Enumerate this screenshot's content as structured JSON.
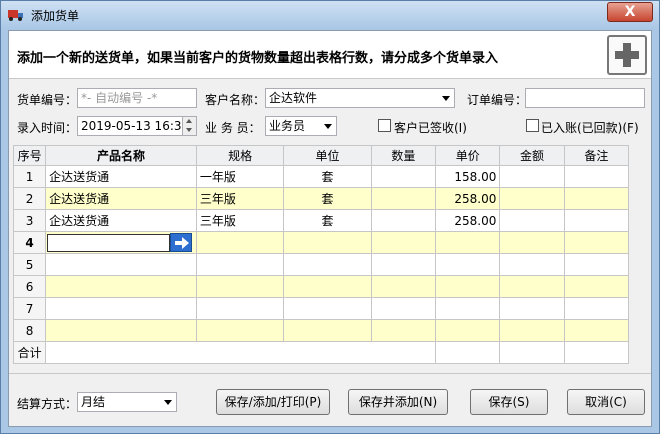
{
  "window": {
    "title": "添加货单",
    "close_label": "X"
  },
  "banner": {
    "text": "添加一个新的送货单，如果当前客户的货物数量超出表格行数，请分成多个货单录入"
  },
  "form": {
    "order_no_label": "货单编号：",
    "order_no_placeholder": "*- 自动编号 -*",
    "customer_label": "客户名称：",
    "customer_value": "企达软件",
    "po_no_label": "订单编号：",
    "po_no_value": "",
    "entry_time_label": "录入时间：",
    "entry_time_value": "2019-05-13 16:30",
    "clerk_label": "业 务 员：",
    "clerk_value": "业务员",
    "signed_label": "客户已签收(I)",
    "signed_checked": false,
    "paid_label": "已入账(已回款)(F)",
    "paid_checked": false
  },
  "table": {
    "columns": [
      "序号",
      "产品名称",
      "规格",
      "单位",
      "数量",
      "单价",
      "金额",
      "备注"
    ],
    "rows": [
      {
        "no": "1",
        "name": "企达送货通",
        "spec": "一年版",
        "unit": "套",
        "qty": "",
        "price": "158.00",
        "amount": "",
        "note": ""
      },
      {
        "no": "2",
        "name": "企达送货通",
        "spec": "三年版",
        "unit": "套",
        "qty": "",
        "price": "258.00",
        "amount": "",
        "note": ""
      },
      {
        "no": "3",
        "name": "企达送货通",
        "spec": "三年版",
        "unit": "套",
        "qty": "",
        "price": "258.00",
        "amount": "",
        "note": ""
      },
      {
        "no": "4",
        "name": "",
        "spec": "",
        "unit": "",
        "qty": "",
        "price": "",
        "amount": "",
        "note": ""
      },
      {
        "no": "5",
        "name": "",
        "spec": "",
        "unit": "",
        "qty": "",
        "price": "",
        "amount": "",
        "note": ""
      },
      {
        "no": "6",
        "name": "",
        "spec": "",
        "unit": "",
        "qty": "",
        "price": "",
        "amount": "",
        "note": ""
      },
      {
        "no": "7",
        "name": "",
        "spec": "",
        "unit": "",
        "qty": "",
        "price": "",
        "amount": "",
        "note": ""
      },
      {
        "no": "8",
        "name": "",
        "spec": "",
        "unit": "",
        "qty": "",
        "price": "",
        "amount": "",
        "note": ""
      }
    ],
    "total_label": "合计"
  },
  "footer": {
    "settlement_label": "结算方式：",
    "settlement_value": "月结",
    "btn_save_add_print": "保存/添加/打印(P)",
    "btn_save_add": "保存并添加(N)",
    "btn_save": "保存(S)",
    "btn_cancel": "取消(C)"
  },
  "colors": {
    "alt_row": "#ffffcc",
    "accent": "#2d6fd1"
  }
}
